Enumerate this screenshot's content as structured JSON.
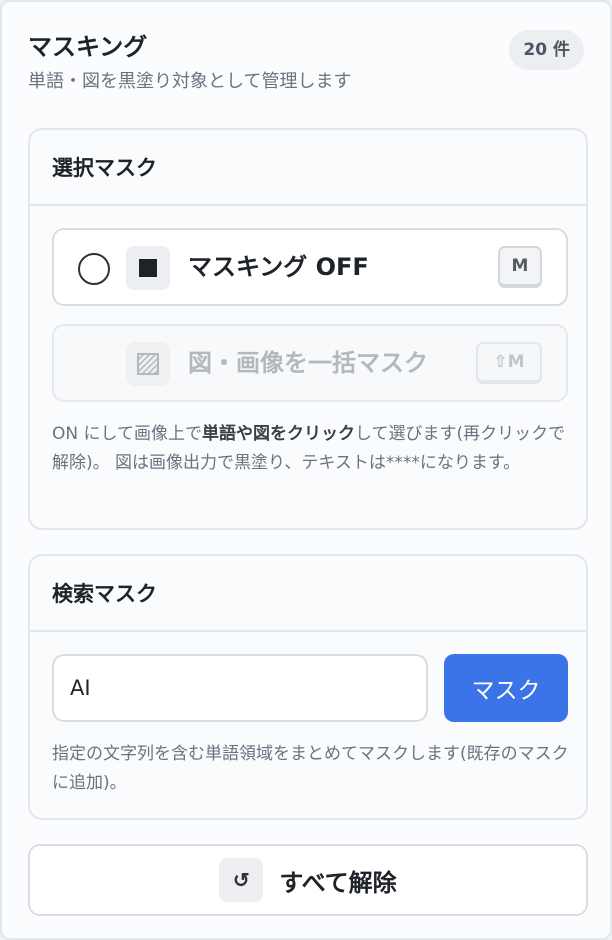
{
  "header": {
    "title": "マスキング",
    "subtitle": "単語・図を黒塗り対象として管理します",
    "count": "20 件"
  },
  "selection_mask": {
    "title": "選択マスク",
    "toggle": {
      "label": "マスキング OFF",
      "shortcut": "M",
      "icon": "filled-square-icon",
      "state": "off"
    },
    "bulk_figure": {
      "label": "図・画像を一括マスク",
      "shortcut": "⇧M",
      "icon": "hatched-square-icon",
      "disabled": true
    },
    "help_prefix": "ON にして画像上で",
    "help_bold": "単語や図をクリック",
    "help_suffix": "して選びます(再クリックで解除)。 図は画像出力で黒塗り、テキストは****になります。"
  },
  "search_mask": {
    "title": "検索マスク",
    "input_value": "AI",
    "button_label": "マスク",
    "help": "指定の文字列を含む単語領域をまとめてマスクします(既存のマスクに追加)。"
  },
  "clear_all": {
    "label": "すべて解除",
    "icon": "undo-icon"
  },
  "colors": {
    "accent": "#3b74e8",
    "muted_text": "#6b7280",
    "border": "#e3e6ea"
  }
}
